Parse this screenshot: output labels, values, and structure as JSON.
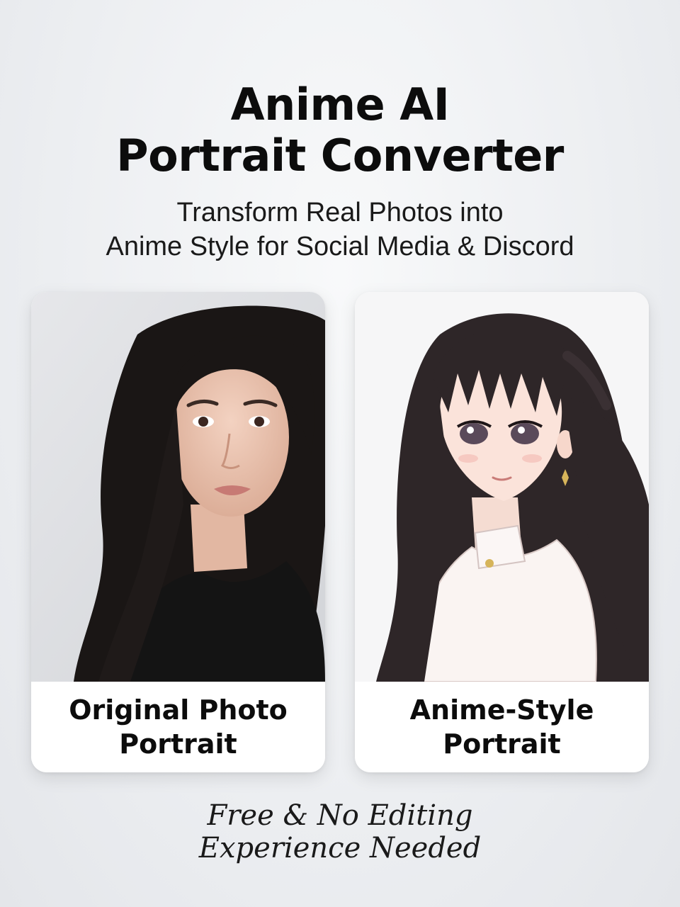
{
  "header": {
    "title_line1": "Anime AI",
    "title_line2": "Portrait Converter",
    "subtitle_line1": "Transform Real Photos into",
    "subtitle_line2": "Anime Style for Social Media & Discord"
  },
  "cards": [
    {
      "caption_line1": "Original Photo",
      "caption_line2": "Portrait",
      "image": "real-woman-portrait"
    },
    {
      "caption_line1": "Anime-Style",
      "caption_line2": "Portrait",
      "image": "anime-woman-portrait"
    }
  ],
  "footer": {
    "line1": "Free & No Editing",
    "line2": "Experience Needed"
  },
  "colors": {
    "background": "#eceef1",
    "text": "#0c0c0c",
    "card": "#ffffff"
  }
}
